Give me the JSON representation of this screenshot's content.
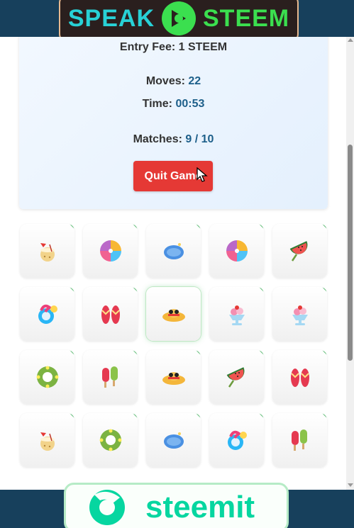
{
  "banner_top": {
    "word_left": "SPEAK",
    "word_right": "STEEM"
  },
  "stats": {
    "entry_fee": "Entry Fee: 1 STEEM",
    "moves_label": "Moves:",
    "moves_value": "22",
    "time_label": "Time:",
    "time_value": "00:53",
    "matches_label": "Matches:",
    "matches_value": "9 / 10"
  },
  "quit_label": "Quit Game",
  "cards": [
    {
      "icon": "coconut-drink"
    },
    {
      "icon": "beach-ball"
    },
    {
      "icon": "blue-pool"
    },
    {
      "icon": "beach-ball"
    },
    {
      "icon": "watermelon-slice"
    },
    {
      "icon": "flamingo-float"
    },
    {
      "icon": "flip-flops"
    },
    {
      "icon": "sun-hat",
      "highlighted": true
    },
    {
      "icon": "ice-cream-sundae"
    },
    {
      "icon": "ice-cream-sundae"
    },
    {
      "icon": "swim-ring"
    },
    {
      "icon": "popsicles"
    },
    {
      "icon": "sun-hat"
    },
    {
      "icon": "watermelon-slice"
    },
    {
      "icon": "flip-flops"
    },
    {
      "icon": "coconut-drink"
    },
    {
      "icon": "swim-ring"
    },
    {
      "icon": "blue-pool"
    },
    {
      "icon": "flamingo-float"
    },
    {
      "icon": "popsicles"
    }
  ],
  "banner_bottom": {
    "word": "steemit"
  },
  "colors": {
    "header_bg": "#17405c",
    "quit_bg": "#e53935",
    "value_text": "#1d5f8a",
    "matched_corner": "#3aae55",
    "steemit_green": "#06d6a0"
  }
}
